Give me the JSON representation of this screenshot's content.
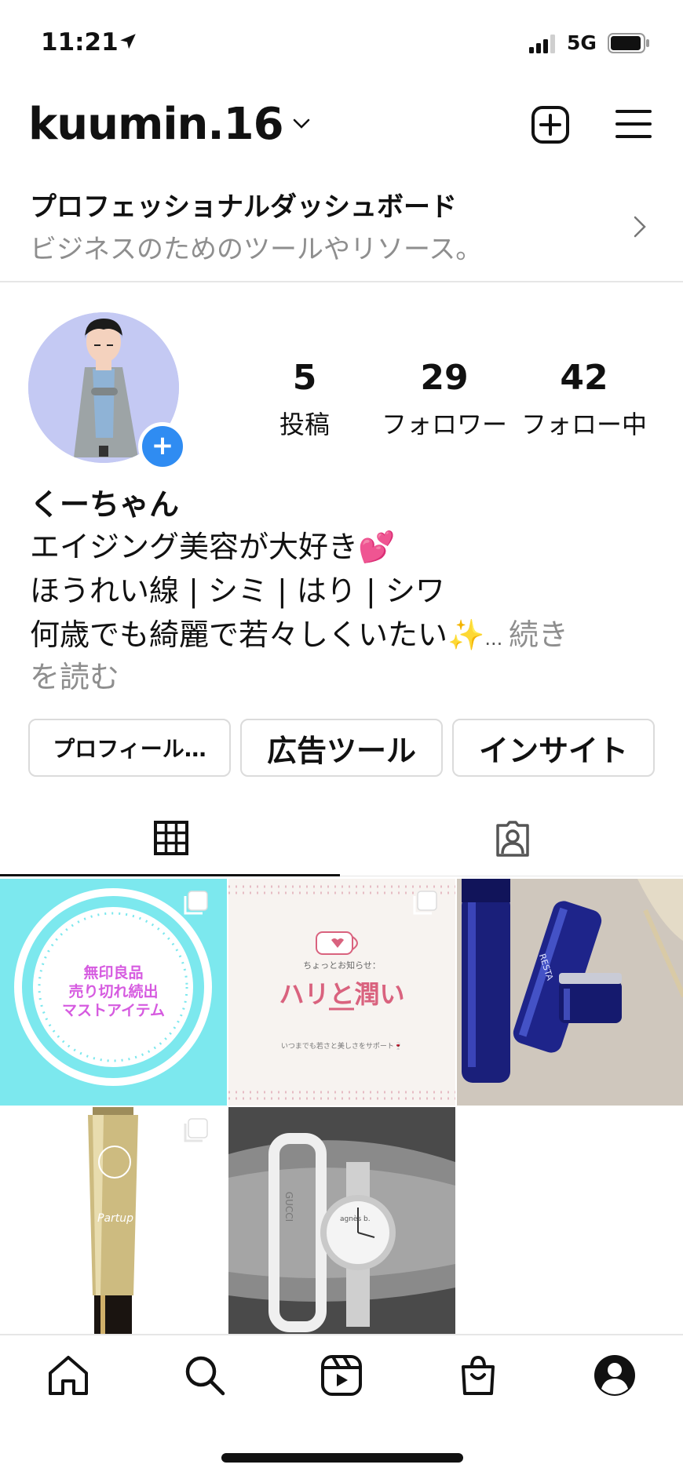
{
  "status": {
    "time": "11:21",
    "network": "5G",
    "icons": [
      "location-arrow-icon",
      "signal-icon",
      "battery-icon"
    ]
  },
  "header": {
    "username": "kuumin.16",
    "icons": [
      "chevron-down-icon",
      "plus-square-icon",
      "hamburger-menu-icon"
    ]
  },
  "dashboard": {
    "title": "プロフェッショナルダッシュボード",
    "subtitle": "ビジネスのためのツールやリソース。"
  },
  "stats": {
    "posts_value": "5",
    "posts_label": "投稿",
    "followers_value": "29",
    "followers_label": "フォロワー",
    "following_value": "42",
    "following_label": "フォロー中"
  },
  "bio": {
    "name": "くーちゃん",
    "line1": "エイジング美容が大好き💕",
    "line2": "ほうれい線 | シミ | はり | シワ",
    "line3": "何歳でも綺麗で若々しくいたい✨",
    "ellipsis": "... ",
    "more_a": "続き",
    "more_b": "を読む"
  },
  "buttons": {
    "edit": "プロフィール…",
    "ads": "広告ツール",
    "insights": "インサイト"
  },
  "posts": {
    "post1": {
      "text1": "無印良品",
      "text2": "売り切れ続出",
      "text3": "マストアイテム"
    },
    "post2": {
      "small": "ちょっとお知らせ：",
      "title": "ハリと潤い",
      "foot": "いつまでも若さと美しさをサポート🍷"
    },
    "post3": {
      "brand": "RESTA"
    },
    "post4": {
      "brand": "Partup"
    },
    "post5": {
      "brand": "GUCCI",
      "watch": "agnès b."
    }
  },
  "colors": {
    "accent": "#2F8CF2",
    "muted": "#8E8E8E",
    "border": "#DBDBDB",
    "post1_bg": "#7CE8EE",
    "post1_text": "#D65BE0",
    "post2_title": "#D9627E"
  }
}
